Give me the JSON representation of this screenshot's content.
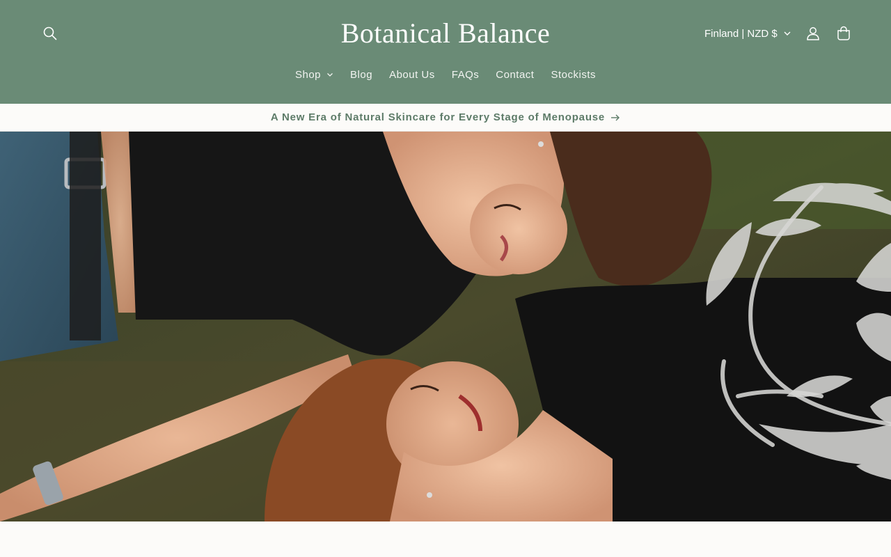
{
  "header": {
    "brand": "Botanical Balance",
    "locale_label": "Finland | NZD $",
    "icons": {
      "search": "search-icon",
      "account": "account-icon",
      "cart": "cart-icon"
    },
    "background_color": "#6a8b76"
  },
  "nav": {
    "items": [
      {
        "label": "Shop",
        "has_dropdown": true
      },
      {
        "label": "Blog"
      },
      {
        "label": "About Us"
      },
      {
        "label": "FAQs"
      },
      {
        "label": "Contact"
      },
      {
        "label": "Stockists"
      }
    ]
  },
  "announcement": {
    "text": "A New Era of Natural Skincare for Every Stage of Menopause",
    "icon": "arrow-right-icon",
    "color": "#5d7b68"
  },
  "hero": {
    "image": "hero-photo",
    "overlay": "leaf-branch-decoration"
  }
}
